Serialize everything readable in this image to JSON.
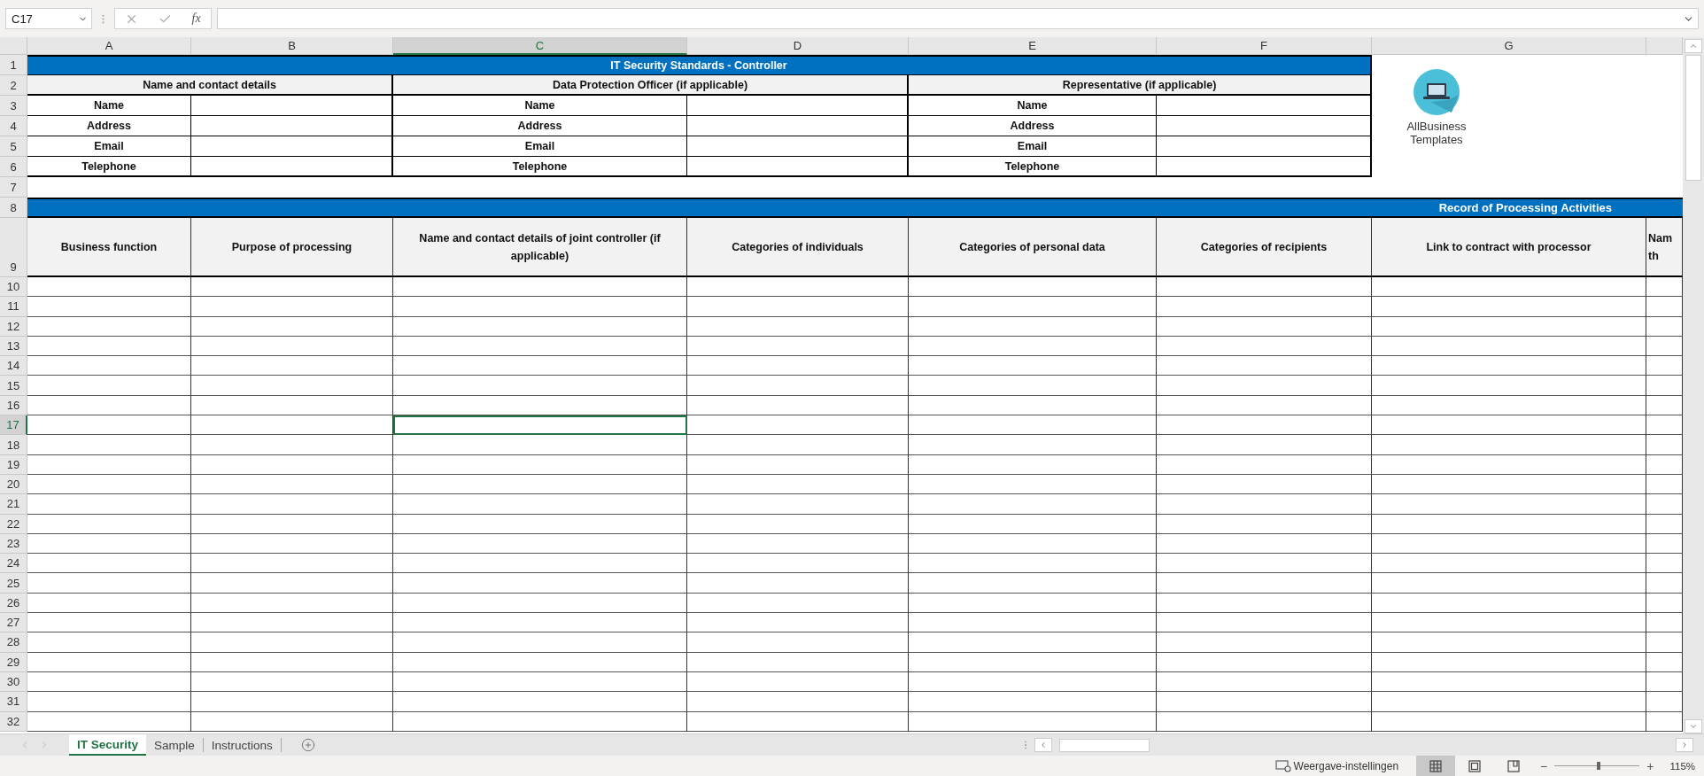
{
  "formula_bar": {
    "name_box": "C17",
    "function_label": "fx"
  },
  "columns": [
    {
      "letter": "A",
      "selected": false
    },
    {
      "letter": "B",
      "selected": false
    },
    {
      "letter": "C",
      "selected": true
    },
    {
      "letter": "D",
      "selected": false
    },
    {
      "letter": "E",
      "selected": false
    },
    {
      "letter": "F",
      "selected": false
    },
    {
      "letter": "G",
      "selected": false
    }
  ],
  "logo": {
    "lines": [
      "AllBusiness",
      "Templates"
    ]
  },
  "rows": [
    {
      "number": "1",
      "selected": false,
      "kind": "title",
      "text": "IT Security Standards - Controller"
    },
    {
      "number": "2",
      "selected": false,
      "kind": "groups",
      "cells": [
        "Name and contact details",
        "Data Protection Officer (if applicable)",
        "Representative (if applicable)"
      ]
    },
    {
      "number": "3",
      "selected": false,
      "kind": "labels",
      "cells": [
        "Name",
        "Name",
        "Name"
      ]
    },
    {
      "number": "4",
      "selected": false,
      "kind": "labels",
      "cells": [
        "Address",
        "Address",
        "Address"
      ]
    },
    {
      "number": "5",
      "selected": false,
      "kind": "labels",
      "cells": [
        "Email",
        "Email",
        "Email"
      ]
    },
    {
      "number": "6",
      "selected": false,
      "kind": "labels",
      "cells": [
        "Telephone",
        "Telephone",
        "Telephone"
      ]
    },
    {
      "number": "7",
      "selected": false,
      "kind": "blank"
    },
    {
      "number": "8",
      "selected": false,
      "kind": "banner",
      "text": "Record of Processing Activities"
    },
    {
      "number": "9",
      "selected": false,
      "kind": "headers",
      "cells": [
        "Business function",
        "Purpose of processing",
        "Name and contact details of joint controller (if applicable)",
        "Categories of individuals",
        "Categories of personal data",
        "Categories of recipients",
        "Link to contract with processor",
        "Nam th"
      ]
    },
    {
      "number": "10",
      "selected": false,
      "kind": "data"
    },
    {
      "number": "11",
      "selected": false,
      "kind": "data"
    },
    {
      "number": "12",
      "selected": false,
      "kind": "data"
    },
    {
      "number": "13",
      "selected": false,
      "kind": "data"
    },
    {
      "number": "14",
      "selected": false,
      "kind": "data"
    },
    {
      "number": "15",
      "selected": false,
      "kind": "data"
    },
    {
      "number": "16",
      "selected": false,
      "kind": "data"
    },
    {
      "number": "17",
      "selected": true,
      "kind": "data"
    },
    {
      "number": "18",
      "selected": false,
      "kind": "data"
    },
    {
      "number": "19",
      "selected": false,
      "kind": "data"
    },
    {
      "number": "20",
      "selected": false,
      "kind": "data"
    },
    {
      "number": "21",
      "selected": false,
      "kind": "data"
    },
    {
      "number": "22",
      "selected": false,
      "kind": "data"
    },
    {
      "number": "23",
      "selected": false,
      "kind": "data"
    },
    {
      "number": "24",
      "selected": false,
      "kind": "data"
    },
    {
      "number": "25",
      "selected": false,
      "kind": "data"
    },
    {
      "number": "26",
      "selected": false,
      "kind": "data"
    },
    {
      "number": "27",
      "selected": false,
      "kind": "data"
    },
    {
      "number": "28",
      "selected": false,
      "kind": "data"
    },
    {
      "number": "29",
      "selected": false,
      "kind": "data"
    },
    {
      "number": "30",
      "selected": false,
      "kind": "data"
    },
    {
      "number": "31",
      "selected": false,
      "kind": "data"
    },
    {
      "number": "32",
      "selected": false,
      "kind": "data"
    }
  ],
  "sheet_tabs": [
    {
      "label": "IT Security",
      "selected": true
    },
    {
      "label": "Sample",
      "selected": false
    },
    {
      "label": "Instructions",
      "selected": false
    }
  ],
  "status_bar": {
    "display_settings": "Weergave-instellingen",
    "views": [
      {
        "kind": "normal",
        "selected": true
      },
      {
        "kind": "page_layout",
        "selected": false
      },
      {
        "kind": "page_break",
        "selected": false
      }
    ],
    "zoom_out": "−",
    "zoom_in": "+",
    "zoom": {
      "level": 0.52,
      "reading": "115%"
    }
  }
}
